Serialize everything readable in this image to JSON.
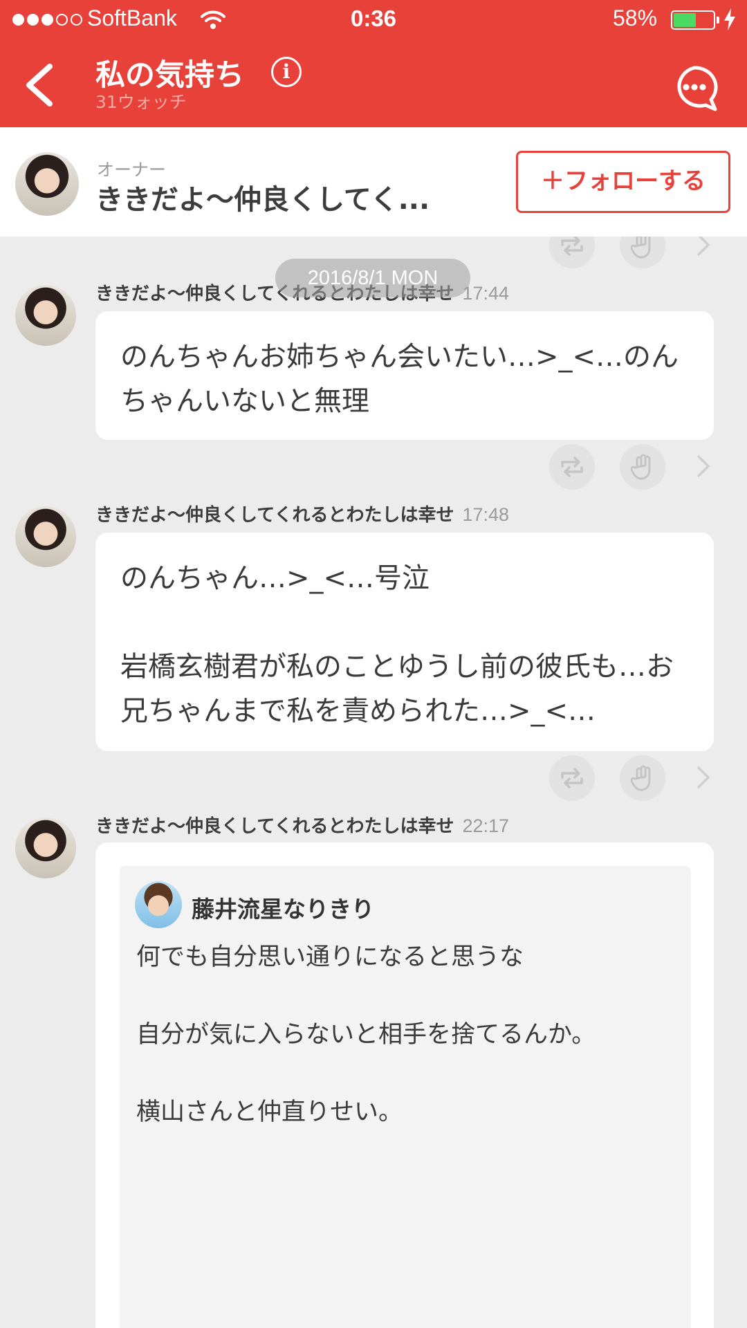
{
  "status_bar": {
    "carrier": "SoftBank",
    "time": "0:36",
    "battery_percent": "58%",
    "battery_level": 0.58,
    "signal_bars": 3,
    "signal_total": 5
  },
  "nav": {
    "title": "私の気持ち",
    "watch_count": "31ウォッチ",
    "info_glyph": "i",
    "icons": {
      "back": "back-chevron-icon",
      "info": "info-icon",
      "chat": "chat-bubble-icon"
    }
  },
  "owner": {
    "label": "オーナー",
    "name": "ききだよ〜仲良くしてく...",
    "follow_button": "＋フォローする"
  },
  "feed": {
    "date_separator": "2016/8/1 MON",
    "messages": [
      {
        "author": "ききだよ〜仲良くしてくれるとわたしは幸せ",
        "time": "17:44",
        "text": "のんちゃんお姉ちゃん会いたい…>_<…のんちゃんいないと無理"
      },
      {
        "author": "ききだよ〜仲良くしてくれるとわたしは幸せ",
        "time": "17:48",
        "text": "のんちゃん…>_<…号泣\n\n岩橋玄樹君が私のことゆうし前の彼氏も…お兄ちゃんまで私を責められた…>_<…"
      },
      {
        "author": "ききだよ〜仲良くしてくれるとわたしは幸せ",
        "time": "22:17",
        "quote": {
          "name": "藤井流星なりきり",
          "text": "何でも自分思い通りになると思うな\n\n自分が気に入らないと相手を捨てるんか。\n\n横山さんと仲直りせい。"
        }
      }
    ],
    "action_icons": [
      "repost-icon",
      "hand-icon",
      "chevron-right-icon"
    ]
  },
  "colors": {
    "brand_red": "#e8413a",
    "background": "#ececec",
    "battery_green": "#4cd964"
  }
}
